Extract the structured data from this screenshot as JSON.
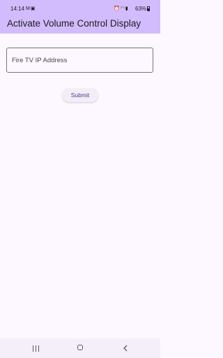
{
  "status_bar": {
    "time": "14:14",
    "battery": "63%",
    "left_icons": [
      "notification-m-icon",
      "notification-gallery-icon"
    ],
    "right_icons": [
      "alarm-icon",
      "wifi-icon",
      "signal-icon"
    ]
  },
  "app_bar": {
    "title": "Activate Volume Control Display",
    "color": "#d3bcfd"
  },
  "form": {
    "ip_field_placeholder": "Fire TV IP Address",
    "ip_field_value": "",
    "submit_label": "Submit"
  },
  "nav_bar": {
    "buttons": [
      "recent-apps-icon",
      "home-icon",
      "back-icon"
    ]
  },
  "colors": {
    "background": "#fdf7ff",
    "accent": "#4f378b"
  }
}
